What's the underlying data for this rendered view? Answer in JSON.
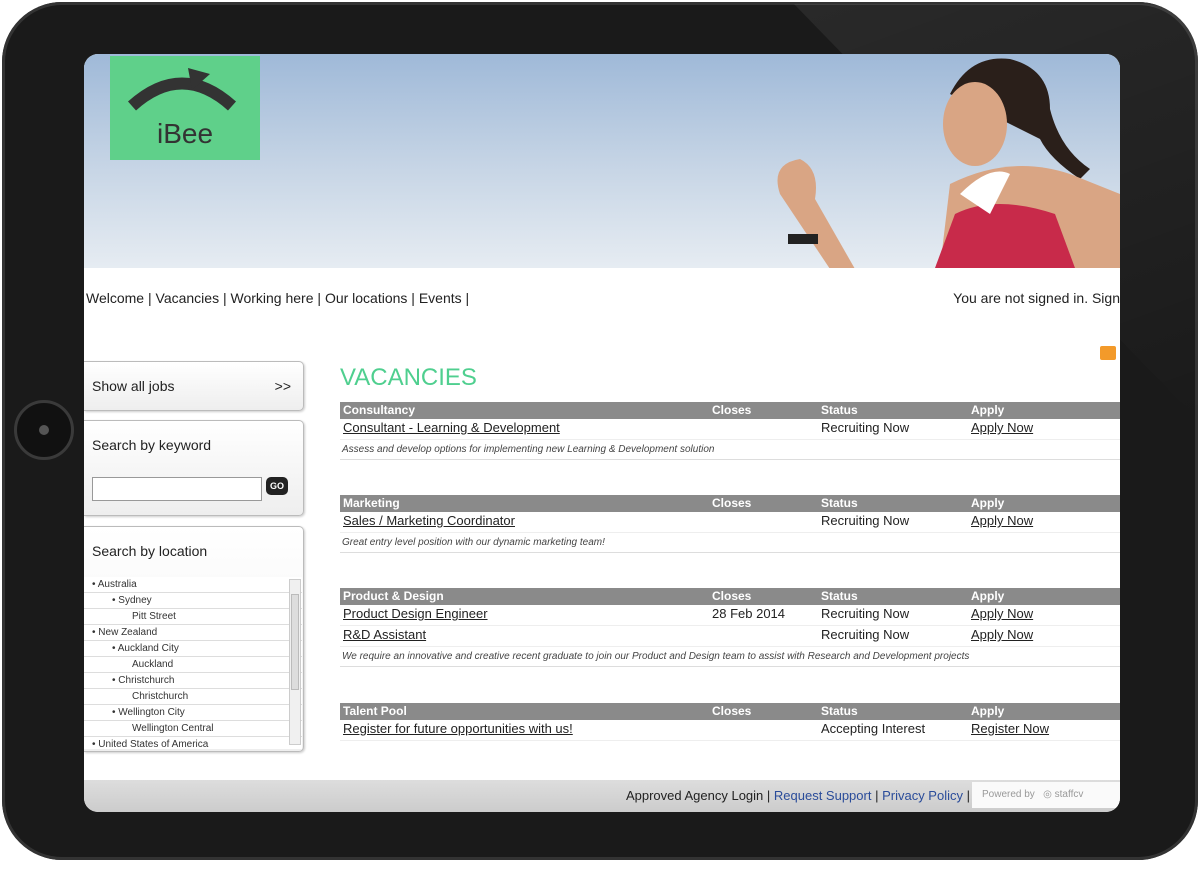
{
  "logo": {
    "text": "iBee",
    "color": "#5fd08a"
  },
  "nav": {
    "items": [
      "Welcome",
      "Vacancies",
      "Working here",
      "Our locations",
      "Events"
    ],
    "signin": "You are not signed in. Sign"
  },
  "sidebar": {
    "show_all": "Show all jobs",
    "show_all_arrow": ">>",
    "keyword_label": "Search by keyword",
    "keyword_value": "",
    "go_label": "GO",
    "location_label": "Search by location",
    "locations": [
      {
        "label": "Australia",
        "level": 0
      },
      {
        "label": "Sydney",
        "level": 1
      },
      {
        "label": "Pitt Street",
        "level": 2
      },
      {
        "label": "New Zealand",
        "level": 0
      },
      {
        "label": "Auckland City",
        "level": 1
      },
      {
        "label": "Auckland",
        "level": 2
      },
      {
        "label": "Christchurch",
        "level": 1
      },
      {
        "label": "Christchurch",
        "level": 2
      },
      {
        "label": "Wellington City",
        "level": 1
      },
      {
        "label": "Wellington Central",
        "level": 2
      },
      {
        "label": "United States of America",
        "level": 0
      }
    ]
  },
  "main": {
    "title": "VACANCIES",
    "groups": [
      {
        "name": "Consultancy",
        "closes": "Closes",
        "status": "Status",
        "apply": "Apply",
        "jobs": [
          {
            "title": "Consultant - Learning & Development",
            "closes": "",
            "status": "Recruiting Now",
            "apply": "Apply Now"
          }
        ],
        "desc": "Assess and develop options for implementing new Learning & Development solution"
      },
      {
        "name": "Marketing",
        "closes": "Closes",
        "status": "Status",
        "apply": "Apply",
        "jobs": [
          {
            "title": "Sales / Marketing Coordinator",
            "closes": "",
            "status": "Recruiting Now",
            "apply": "Apply Now"
          }
        ],
        "desc": "Great entry level position with our dynamic marketing team!"
      },
      {
        "name": "Product & Design",
        "closes": "Closes",
        "status": "Status",
        "apply": "Apply",
        "jobs": [
          {
            "title": "Product Design Engineer",
            "closes": "28 Feb 2014",
            "status": "Recruiting Now",
            "apply": "Apply Now"
          },
          {
            "title": "R&D Assistant",
            "closes": "",
            "status": "Recruiting Now",
            "apply": "Apply Now"
          }
        ],
        "desc": "We require an innovative and creative recent graduate to join our Product and Design team to assist with Research and Development projects"
      },
      {
        "name": "Talent Pool",
        "closes": "Closes",
        "status": "Status",
        "apply": "Apply",
        "jobs": [
          {
            "title": "Register for future opportunities with us!",
            "closes": "",
            "status": "Accepting Interest",
            "apply": "Register Now"
          }
        ],
        "desc": ""
      }
    ]
  },
  "footer": {
    "agency": "Approved Agency Login",
    "support": "Request Support",
    "privacy": "Privacy Policy",
    "powered": "Powered by",
    "brand": "staffcv"
  }
}
